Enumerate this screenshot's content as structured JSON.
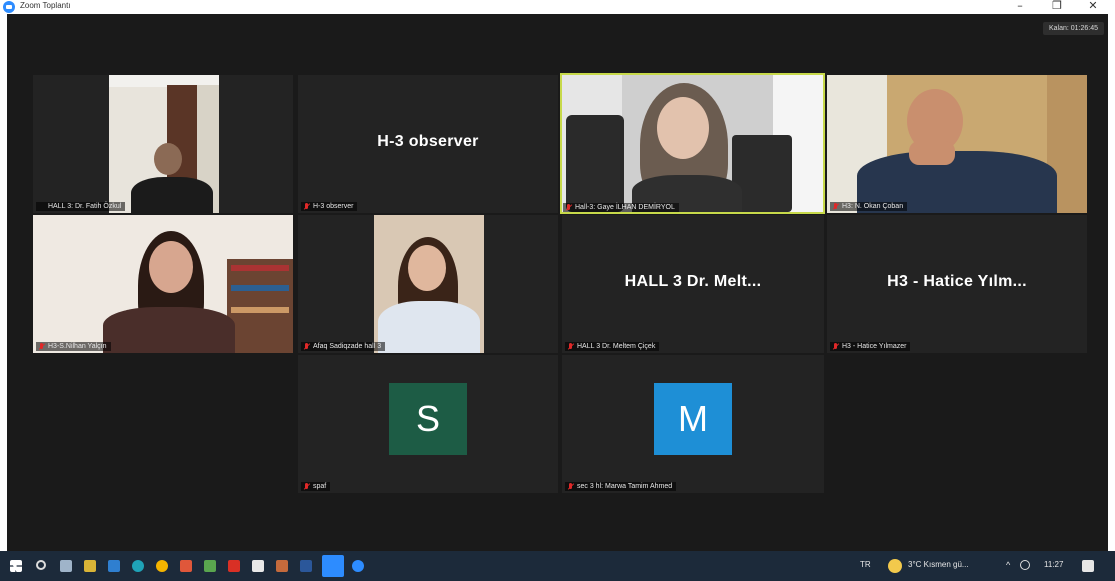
{
  "window": {
    "title": "Zoom Toplantı",
    "minimize": "–",
    "restore": "❐",
    "close": "✕"
  },
  "meeting": {
    "timer": "Kalan: 01:26:45"
  },
  "tiles": [
    {
      "name": "HALL 3: Dr. Fatih Özkul"
    },
    {
      "name": "H-3 observer",
      "display": "H-3 observer"
    },
    {
      "name": "Hall-3: Gaye İLHAN DEMİRYOL"
    },
    {
      "name": "H3: N. Okan Çoban"
    },
    {
      "name": "H3-S.Nilhan Yalçın"
    },
    {
      "name": "Afaq Sadiqzade hall 3"
    },
    {
      "name": "HALL 3 Dr. Meltem Çiçek",
      "display": "HALL 3 Dr. Melt..."
    },
    {
      "name": "H3 - Hatice Yılmazer",
      "display": "H3 - Hatice Yılm..."
    },
    {
      "name": "spaf",
      "initial": "S"
    },
    {
      "name": "sec 3 hl: Marwa Tamim Ahmed",
      "initial": "M"
    }
  ],
  "colors": {
    "stage": "#1a1a1a",
    "tile": "#232323",
    "active_border": "#c7d94a",
    "avatar_s": "#1d5c45",
    "avatar_m": "#1e8fd6",
    "muted": "#e02828"
  },
  "taskbar": {
    "lang": "TR",
    "weather": "3°C  Kısmen gü...",
    "time": "11:27"
  }
}
